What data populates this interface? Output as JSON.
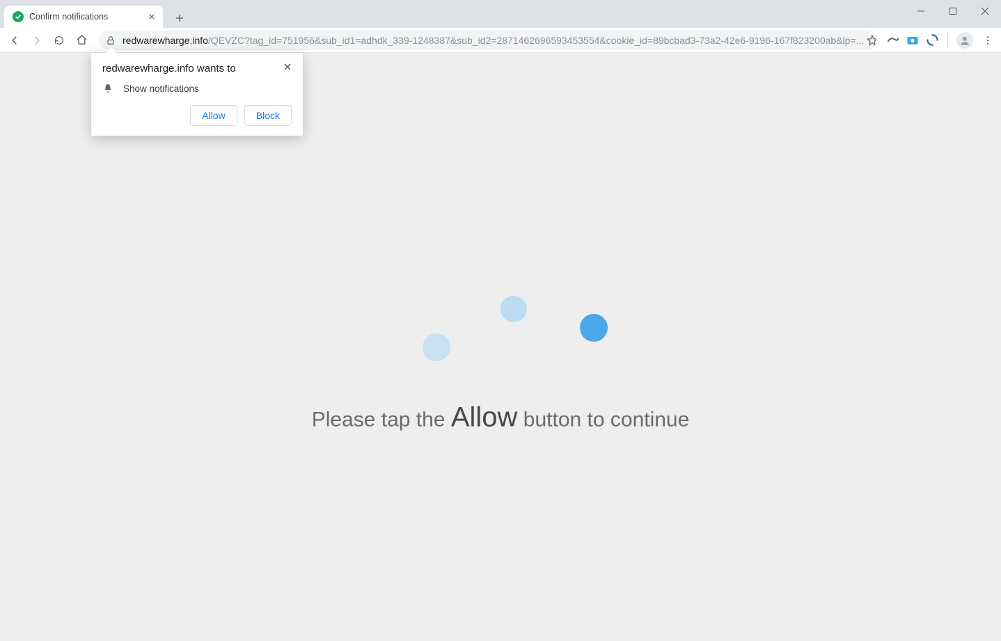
{
  "tab": {
    "title": "Confirm notifications"
  },
  "url": {
    "domain": "redwarewharge.info",
    "path": "/QEVZC?tag_id=751956&sub_id1=adhdk_339-1248387&sub_id2=2871462696593453554&cookie_id=89bcbad3-73a2-42e6-9196-167f823200ab&lp=..."
  },
  "permission_dialog": {
    "title": "redwarewharge.info wants to",
    "item": "Show notifications",
    "allow_label": "Allow",
    "block_label": "Block"
  },
  "page_content": {
    "pre": "Please tap the ",
    "strong": "Allow",
    "post": " button to continue"
  }
}
